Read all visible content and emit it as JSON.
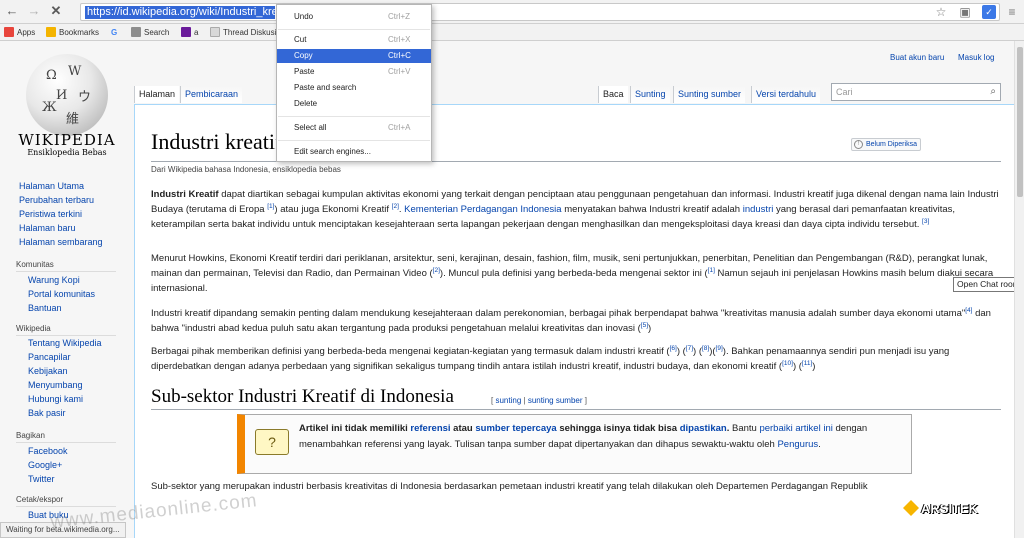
{
  "browser": {
    "url": "https://id.wikipedia.org/wiki/Industri_kreatif",
    "tab_close_glyph": "✕",
    "bookmarks": [
      {
        "label": "Apps",
        "color": "#e8453c"
      },
      {
        "label": "Bookmarks",
        "color": "#f4b400"
      },
      {
        "label": "G",
        "color": "#4285f4"
      },
      {
        "label": "Search",
        "color": "#8e8e8e"
      },
      {
        "label": "a",
        "color": "#6a1b9a"
      },
      {
        "label": "Thread Diskusi",
        "color": "#d8d8d8"
      }
    ],
    "status": "Waiting for beta.wikimedia.org..."
  },
  "context_menu": {
    "items": [
      {
        "label": "Undo",
        "shortcut": "Ctrl+Z"
      },
      {
        "label": "Cut",
        "shortcut": "Ctrl+X"
      },
      {
        "label": "Copy",
        "shortcut": "Ctrl+C"
      },
      {
        "label": "Paste",
        "shortcut": "Ctrl+V"
      },
      {
        "label": "Paste and search",
        "shortcut": ""
      },
      {
        "label": "Delete",
        "shortcut": ""
      },
      {
        "label": "Select all",
        "shortcut": "Ctrl+A"
      },
      {
        "label": "Edit search engines...",
        "shortcut": ""
      }
    ],
    "highlight_color": "#3367d6"
  },
  "logo": {
    "wordmark": "WIKIPEDIA",
    "tagline": "Ensiklopedia Bebas"
  },
  "sidebar": {
    "main_links": [
      "Halaman Utama",
      "Perubahan terbaru",
      "Peristiwa terkini",
      "Halaman baru",
      "Halaman sembarang"
    ],
    "sections": [
      {
        "heading": "Komunitas",
        "links": [
          "Warung Kopi",
          "Portal komunitas",
          "Bantuan"
        ]
      },
      {
        "heading": "Wikipedia",
        "links": [
          "Tentang Wikipedia",
          "Pancapilar",
          "Kebijakan",
          "Menyumbang",
          "Hubungi kami",
          "Bak pasir"
        ]
      },
      {
        "heading": "Bagikan",
        "links": [
          "Facebook",
          "Google+",
          "Twitter"
        ]
      },
      {
        "heading": "Cetak/ekspor",
        "links": [
          "Buat buku"
        ]
      }
    ]
  },
  "personal": {
    "create_account": "Buat akun baru",
    "login": "Masuk log"
  },
  "tabs": {
    "left": [
      {
        "label": "Halaman"
      },
      {
        "label": "Pembicaraan"
      }
    ],
    "right": [
      {
        "label": "Baca"
      },
      {
        "label": "Sunting"
      },
      {
        "label": "Sunting sumber"
      },
      {
        "label": "Versi terdahulu"
      }
    ]
  },
  "search": {
    "placeholder": "Cari"
  },
  "article": {
    "title": "Industri kreatif",
    "review_badge": "Belum Diperiksa",
    "tagline": "Dari Wikipedia bahasa Indonesia, ensiklopedia bebas",
    "section_title": "Sub-sektor Industri Kreatif di Indonesia",
    "section_edit": {
      "open": "[",
      "sunting": "sunting",
      "sep": "|",
      "sunting_sumber": "sunting sumber",
      "close": "]"
    },
    "notice": {
      "bold_1": "Artikel ini tidak memiliki ",
      "link_1": "referensi",
      "bold_2": " atau ",
      "link_2": "sumber tepercaya",
      "bold_3": " sehingga isinya tidak bisa ",
      "link_3": "dipastikan",
      "bold_4": ".",
      "text_1": " Bantu ",
      "link_4": "perbaiki artikel ini",
      "text_2": " dengan menambahkan referensi yang layak. Tulisan tanpa sumber dapat dipertanyakan dan dihapus sewaktu-waktu oleh ",
      "link_5": "Pengurus",
      "text_3": "."
    },
    "paragraph_5": "Sub-sektor yang merupakan industri berbasis kreativitas di Indonesia berdasarkan pemetaan industri kreatif yang telah dilakukan oleh Departemen Perdagangan Republik"
  },
  "tooltip": "Open Chat room",
  "watermarks": {
    "left": "www.mediaonline.com",
    "right": "ARSITEK"
  }
}
